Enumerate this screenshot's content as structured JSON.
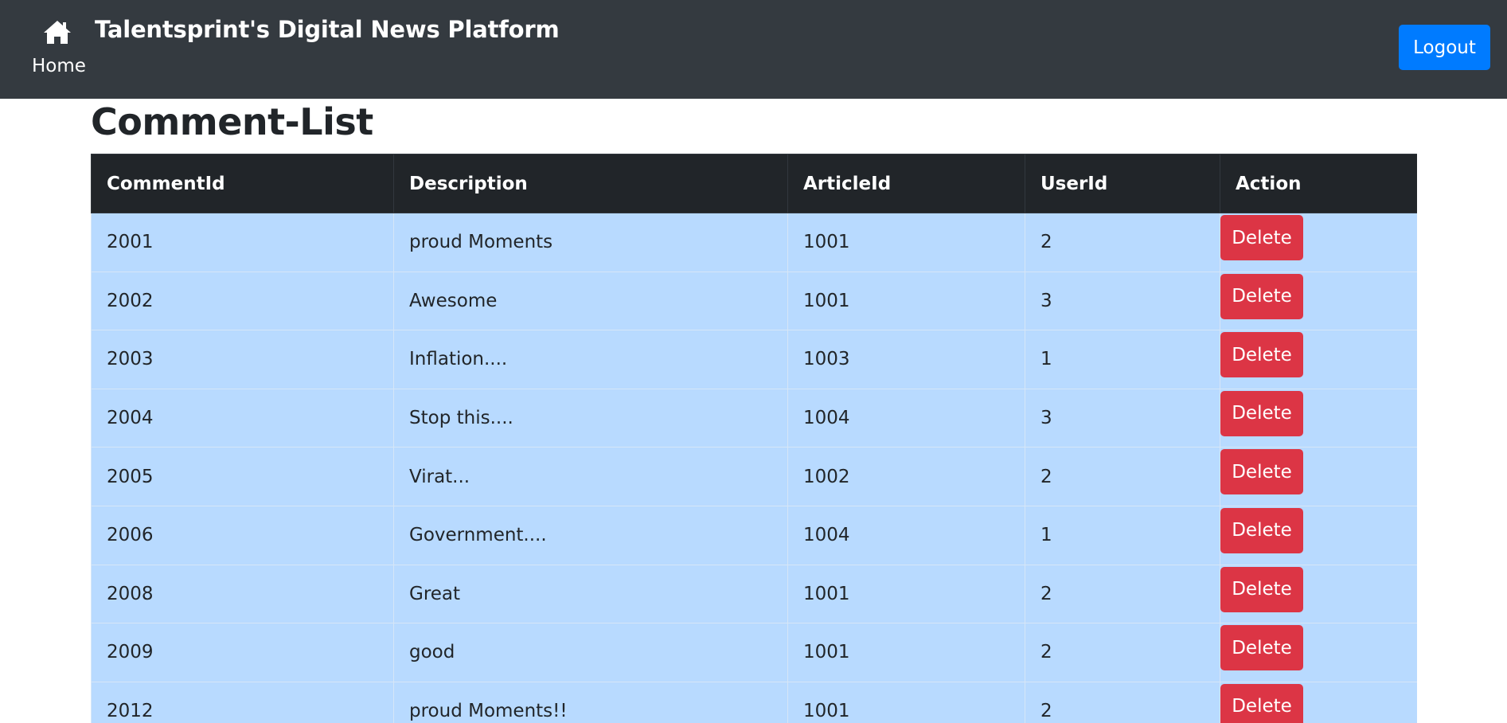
{
  "navbar": {
    "home_icon": "home-icon",
    "brand": "Talentsprint's Digital News Platform",
    "home_link": "Home",
    "logout_label": "Logout",
    "colors": {
      "background": "#343a40",
      "logout": "#007bff"
    }
  },
  "page": {
    "title": "Comment-List"
  },
  "table": {
    "headers": [
      "CommentId",
      "Description",
      "ArticleId",
      "UserId",
      "Action"
    ],
    "delete_label": "Delete",
    "colors": {
      "header": "#212529",
      "row": "#b8daff",
      "delete": "#dc3545"
    },
    "rows": [
      {
        "comment_id": "2001",
        "description": "proud Moments",
        "article_id": "1001",
        "user_id": "2"
      },
      {
        "comment_id": "2002",
        "description": "Awesome",
        "article_id": "1001",
        "user_id": "3"
      },
      {
        "comment_id": "2003",
        "description": "Inflation....",
        "article_id": "1003",
        "user_id": "1"
      },
      {
        "comment_id": "2004",
        "description": "Stop this....",
        "article_id": "1004",
        "user_id": "3"
      },
      {
        "comment_id": "2005",
        "description": "Virat...",
        "article_id": "1002",
        "user_id": "2"
      },
      {
        "comment_id": "2006",
        "description": "Government....",
        "article_id": "1004",
        "user_id": "1"
      },
      {
        "comment_id": "2008",
        "description": "Great",
        "article_id": "1001",
        "user_id": "2"
      },
      {
        "comment_id": "2009",
        "description": "good",
        "article_id": "1001",
        "user_id": "2"
      },
      {
        "comment_id": "2012",
        "description": "proud Moments!!",
        "article_id": "1001",
        "user_id": "2"
      }
    ]
  }
}
